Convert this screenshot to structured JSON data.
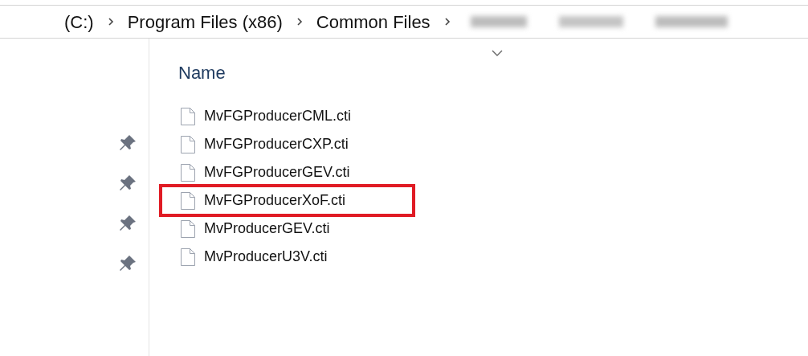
{
  "breadcrumb": [
    "(C:)",
    "Program Files (x86)",
    "Common Files"
  ],
  "quick_access": [
    {
      "pinned": true
    },
    {
      "pinned": true
    },
    {
      "pinned": true
    },
    {
      "pinned": true
    }
  ],
  "column_header": {
    "label": "Name"
  },
  "files": [
    {
      "name": "MvFGProducerCML.cti",
      "highlighted": false
    },
    {
      "name": "MvFGProducerCXP.cti",
      "highlighted": false
    },
    {
      "name": "MvFGProducerGEV.cti",
      "highlighted": false
    },
    {
      "name": "MvFGProducerXoF.cti",
      "highlighted": true
    },
    {
      "name": "MvProducerGEV.cti",
      "highlighted": false
    },
    {
      "name": "MvProducerU3V.cti",
      "highlighted": false
    }
  ]
}
